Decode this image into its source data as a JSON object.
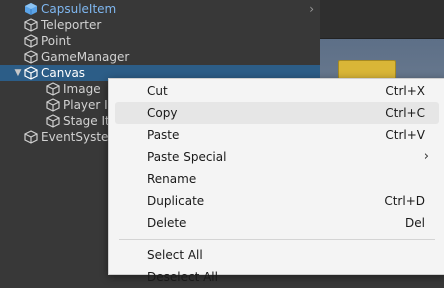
{
  "hierarchy": {
    "items": [
      {
        "label": "CapsuleItem",
        "indent": 1,
        "prefab": true,
        "expandable": false
      },
      {
        "label": "Teleporter",
        "indent": 1,
        "prefab": false,
        "expandable": false
      },
      {
        "label": "Point",
        "indent": 1,
        "prefab": false,
        "expandable": false
      },
      {
        "label": "GameManager",
        "indent": 1,
        "prefab": false,
        "expandable": false
      },
      {
        "label": "Canvas",
        "indent": 1,
        "prefab": false,
        "expandable": true,
        "selected": true
      },
      {
        "label": "Image",
        "indent": 2,
        "prefab": false,
        "expandable": false
      },
      {
        "label": "Player It",
        "indent": 2,
        "prefab": false,
        "expandable": false
      },
      {
        "label": "Stage It",
        "indent": 2,
        "prefab": false,
        "expandable": false
      },
      {
        "label": "EventSyste",
        "indent": 1,
        "prefab": false,
        "expandable": false
      }
    ],
    "colors": {
      "selected": "#2c5d87",
      "prefab_text": "#7fb7f0",
      "text": "#d2d2d2"
    }
  },
  "context_menu": {
    "items": [
      {
        "label": "Cut",
        "shortcut": "Ctrl+X"
      },
      {
        "label": "Copy",
        "shortcut": "Ctrl+C",
        "hovered": true
      },
      {
        "label": "Paste",
        "shortcut": "Ctrl+V"
      },
      {
        "label": "Paste Special",
        "submenu": "›"
      },
      {
        "label": "Rename",
        "shortcut": ""
      },
      {
        "label": "Duplicate",
        "shortcut": "Ctrl+D"
      },
      {
        "label": "Delete",
        "shortcut": "Del"
      },
      {
        "label": "Select All",
        "shortcut": ""
      },
      {
        "label": "Deselect All",
        "shortcut": ""
      }
    ]
  },
  "icons": {
    "expand_arrow": "▼",
    "chevron_right": "›",
    "gameobject": "cube-outline-icon",
    "prefab": "cube-filled-icon"
  }
}
